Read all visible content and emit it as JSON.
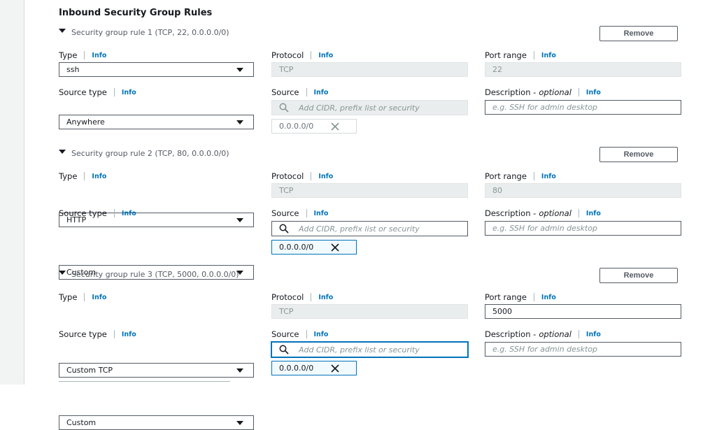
{
  "section": {
    "title": "Inbound Security Group Rules"
  },
  "labels": {
    "type": "Type",
    "protocol": "Protocol",
    "port_range": "Port range",
    "source_type": "Source type",
    "source": "Source",
    "description": "Description -",
    "optional": "optional",
    "info": "Info",
    "remove": "Remove"
  },
  "rules": [
    {
      "header": "Security group rule 1 (TCP, 22, 0.0.0.0/0)",
      "type_value": "ssh",
      "protocol_value": "TCP",
      "port_value": "22",
      "source_type_value": "Anywhere",
      "source_placeholder": "Add CIDR, prefix list or security",
      "description_placeholder": "e.g. SSH for admin desktop",
      "cidr_token": "0.0.0.0/0"
    },
    {
      "header": "Security group rule 2 (TCP, 80, 0.0.0.0/0)",
      "type_value": "HTTP",
      "protocol_value": "TCP",
      "port_value": "80",
      "source_type_value": "Custom",
      "source_placeholder": "Add CIDR, prefix list or security",
      "description_placeholder": "e.g. SSH for admin desktop",
      "cidr_token": "0.0.0.0/0"
    },
    {
      "header": "Security group rule 3 (TCP, 5000, 0.0.0.0/0)",
      "type_value": "Custom TCP",
      "protocol_value": "TCP",
      "port_value": "5000",
      "source_type_value": "Custom",
      "source_placeholder": "Add CIDR, prefix list or security",
      "description_placeholder": "e.g. SSH for admin desktop",
      "cidr_token": "0.0.0.0/0"
    }
  ],
  "icons": [
    "caret-down-icon",
    "dropdown-arrow-icon",
    "search-icon",
    "close-icon"
  ],
  "colors": {
    "info_link": "#0073bb",
    "focus": "#0073bb",
    "disabled_bg": "#eaeded",
    "border": "#545b64"
  }
}
